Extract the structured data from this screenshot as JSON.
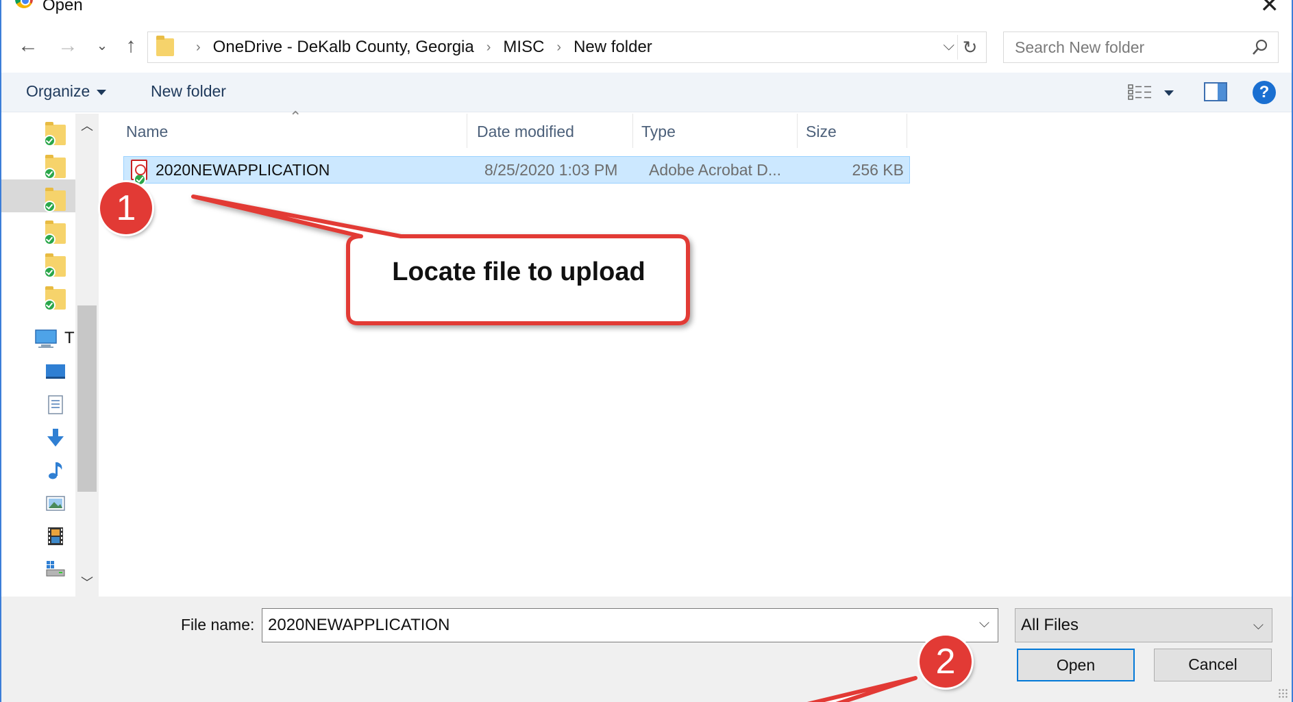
{
  "window": {
    "title": "Open"
  },
  "address": {
    "crumbs": [
      "OneDrive - DeKalb County, Georgia",
      "MISC",
      "New folder"
    ],
    "search_placeholder": "Search New folder"
  },
  "toolbar": {
    "organize": "Organize",
    "new_folder": "New folder"
  },
  "navpane": {
    "computer_label": "T"
  },
  "columns": {
    "name": "Name",
    "date": "Date modified",
    "type": "Type",
    "size": "Size"
  },
  "files": [
    {
      "name": "2020NEWAPPLICATION",
      "date": "8/25/2020 1:03 PM",
      "type": "Adobe Acrobat D...",
      "size": "256 KB",
      "icon": "pdf-icon"
    }
  ],
  "footer": {
    "filename_label": "File name:",
    "filename_value": "2020NEWAPPLICATION",
    "filetype": "All Files",
    "open": "Open",
    "cancel": "Cancel"
  },
  "annotations": {
    "step1": "1",
    "step2": "2",
    "callout": "Locate file to upload",
    "color": "#e23a35"
  }
}
